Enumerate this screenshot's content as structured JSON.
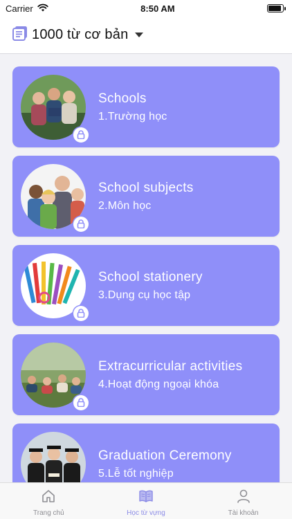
{
  "status": {
    "carrier": "Carrier",
    "time": "8:50 AM",
    "battery_level": 0.9
  },
  "header": {
    "title": "1000 từ cơ bản",
    "icon": "book-list-icon"
  },
  "cards": [
    {
      "title": "Schools",
      "subtitle": "1.Trường học"
    },
    {
      "title": "School subjects",
      "subtitle": "2.Môn học"
    },
    {
      "title": "School stationery",
      "subtitle": "3.Dụng cụ học tập"
    },
    {
      "title": "Extracurricular activities",
      "subtitle": "4.Hoạt động ngoại khóa"
    },
    {
      "title": "Graduation Ceremony",
      "subtitle": "5.Lễ tốt nghiệp"
    }
  ],
  "tabs": [
    {
      "label": "Trang chủ",
      "icon": "home-icon",
      "active": false
    },
    {
      "label": "Học từ vựng",
      "icon": "book-icon",
      "active": true
    },
    {
      "label": "Tài khoản",
      "icon": "user-icon",
      "active": false
    }
  ],
  "colors": {
    "card": "#8f8ff9",
    "active_tab": "#8a8ae6",
    "inactive_tab": "#8e8e93"
  }
}
